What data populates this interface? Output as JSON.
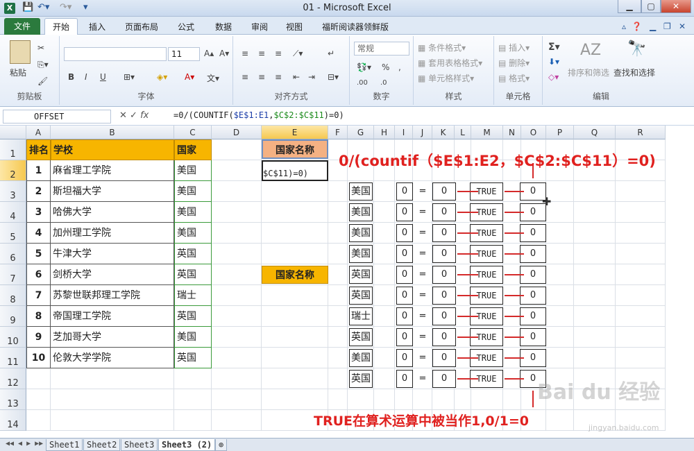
{
  "window": {
    "title": "01 - Microsoft Excel"
  },
  "ribbon": {
    "tabs": [
      "文件",
      "开始",
      "插入",
      "页面布局",
      "公式",
      "数据",
      "审阅",
      "视图",
      "福昕阅读器领鲜版"
    ],
    "groups": [
      "剪贴板",
      "字体",
      "对齐方式",
      "数字",
      "样式",
      "单元格",
      "编辑"
    ],
    "paste": "粘贴",
    "font_size": "11",
    "bold": "B",
    "italic": "I",
    "underline": "U",
    "number_format": "常规",
    "percent": "%",
    "styles": [
      "条件格式",
      "套用表格格式",
      "单元格样式"
    ],
    "cells": [
      "插入",
      "删除",
      "格式"
    ],
    "sort_filter": "排序和筛选",
    "find_select": "查找和选择"
  },
  "formula_bar": {
    "name_box": "OFFSET",
    "fx": "fx",
    "formula_parts": [
      [
        "=0/(COUNTIF(",
        "black"
      ],
      [
        "$E$1:E1",
        "blue"
      ],
      [
        ",",
        "black"
      ],
      [
        "$C$2:$C$11",
        "green"
      ],
      [
        ")=0)",
        "black"
      ]
    ]
  },
  "columns": [
    "A",
    "B",
    "C",
    "D",
    "E",
    "F",
    "G",
    "H",
    "I",
    "J",
    "K",
    "L",
    "M",
    "N",
    "O",
    "P",
    "Q",
    "R"
  ],
  "rows": [
    "1",
    "2",
    "3",
    "4",
    "5",
    "6",
    "7",
    "8",
    "9",
    "10",
    "11",
    "12",
    "13",
    "14"
  ],
  "table": {
    "headers": [
      "排名",
      "学校",
      "国家"
    ],
    "rows": [
      [
        "1",
        "麻省理工学院",
        "美国"
      ],
      [
        "2",
        "斯坦福大学",
        "美国"
      ],
      [
        "3",
        "哈佛大学",
        "美国"
      ],
      [
        "4",
        "加州理工学院",
        "美国"
      ],
      [
        "5",
        "牛津大学",
        "英国"
      ],
      [
        "6",
        "剑桥大学",
        "英国"
      ],
      [
        "7",
        "苏黎世联邦理工学院",
        "瑞士"
      ],
      [
        "8",
        "帝国理工学院",
        "英国"
      ],
      [
        "9",
        "芝加哥大学",
        "美国"
      ],
      [
        "10",
        "伦敦大学学院",
        "英国"
      ]
    ]
  },
  "e_cells": {
    "e1": "国家名称",
    "e2": "$C$11)=0)",
    "e7": "国家名称"
  },
  "demo": {
    "countries": [
      "美国",
      "美国",
      "美国",
      "美国",
      "英国",
      "英国",
      "瑞士",
      "英国",
      "美国",
      "英国"
    ],
    "i_values": [
      "0",
      "0",
      "0",
      "0",
      "0",
      "0",
      "0",
      "0",
      "0",
      "0"
    ],
    "eq": "=",
    "k_values": [
      "0",
      "0",
      "0",
      "0",
      "0",
      "0",
      "0",
      "0",
      "0",
      "0"
    ],
    "m_values": [
      "TRUE",
      "TRUE",
      "TRUE",
      "TRUE",
      "TRUE",
      "TRUE",
      "TRUE",
      "TRUE",
      "TRUE",
      "TRUE"
    ],
    "o_values": [
      "0",
      "0",
      "0",
      "0",
      "0",
      "0",
      "0",
      "0",
      "0",
      "0"
    ]
  },
  "annotations": {
    "top": "0/(countif（$E$1:E2，$C$2:$C$11）=0)",
    "bottom": "TRUE在算术运算中被当作1,0/1=0"
  },
  "sheets": [
    "Sheet1",
    "Sheet2",
    "Sheet3",
    "Sheet3 (2)"
  ],
  "active_sheet": "Sheet3 (2)",
  "watermark": {
    "text": "Bai du 经验",
    "url": "jingyan.baidu.com"
  },
  "colors": {
    "header_fill": "#f7b500",
    "e1_fill": "#f4b183",
    "annotation": "#e0211f",
    "excel_green": "#2b7a3d"
  }
}
